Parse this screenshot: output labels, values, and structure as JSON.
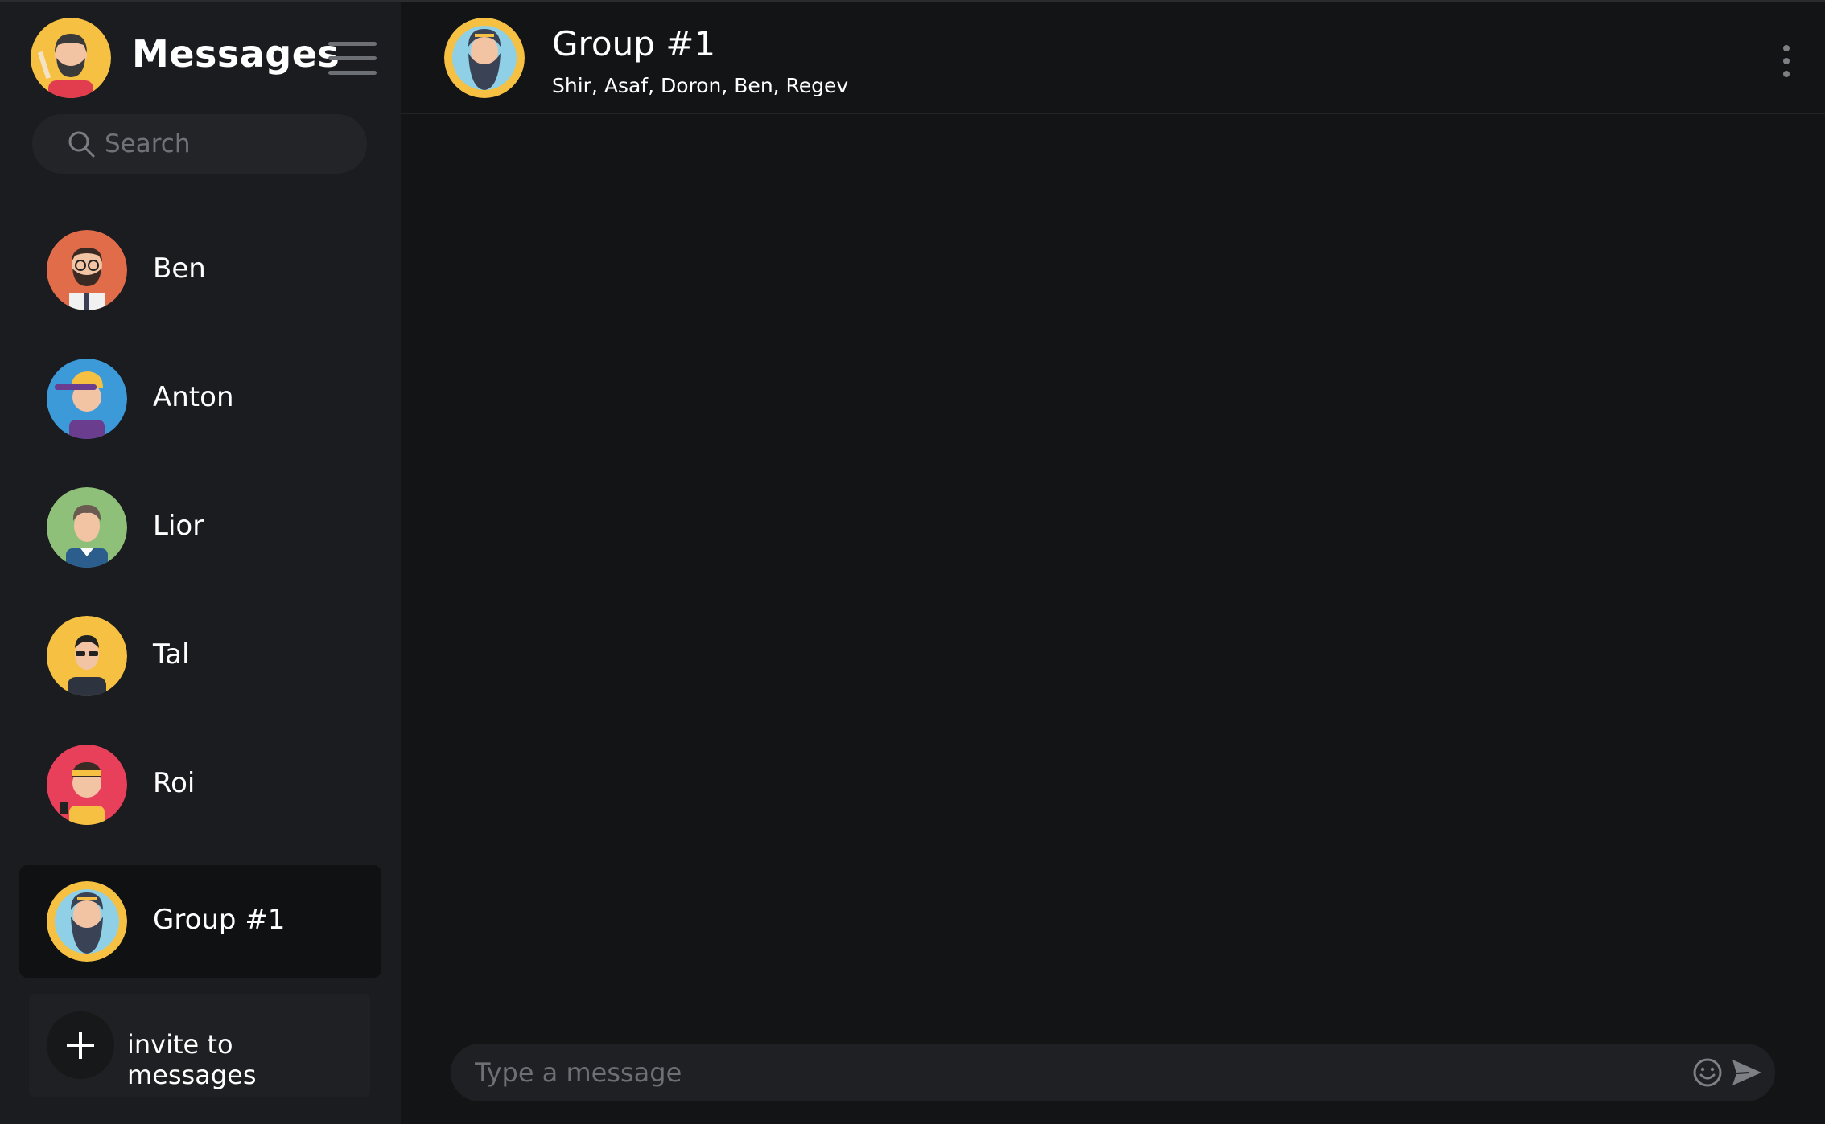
{
  "sidebar": {
    "title": "Messages",
    "search_placeholder": "Search",
    "contacts": [
      {
        "name": "Ben",
        "avatar_color": "#e06c4a"
      },
      {
        "name": "Anton",
        "avatar_color": "#3d9ad9"
      },
      {
        "name": "Lior",
        "avatar_color": "#8ec07a"
      },
      {
        "name": "Tal",
        "avatar_color": "#f6c142"
      },
      {
        "name": "Roi",
        "avatar_color": "#e8405a"
      },
      {
        "name": "Group #1",
        "avatar_color": "#f6c142",
        "active": true
      }
    ],
    "invite_label": "invite to messages"
  },
  "chat": {
    "title": "Group #1",
    "members": "Shir, Asaf, Doron, Ben, Regev",
    "composer_placeholder": "Type a message"
  },
  "icons": {
    "menu": "hamburger-icon",
    "search": "search-icon",
    "more": "more-vertical-icon",
    "emoji": "smiley-icon",
    "send": "send-icon",
    "invite": "plus-icon"
  },
  "colors": {
    "sidebar_bg": "#1b1c1f",
    "chat_bg": "#131416",
    "active_item_bg": "#101113",
    "input_bg": "#1f2023"
  }
}
